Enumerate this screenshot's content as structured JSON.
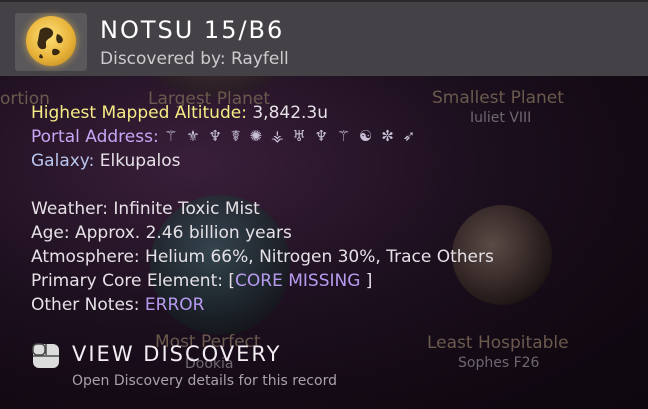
{
  "background": {
    "labels": {
      "portion": "ortion",
      "largest_planet": "Largest Planet",
      "smallest_planet": "Smallest Planet",
      "smallest_planet_name": "Iuliet VIII",
      "most_perfect": "Most Perfect",
      "most_perfect_name": "Dookia",
      "least_hospitable": "Least Hospitable",
      "least_hospitable_name": "Sophes F26"
    }
  },
  "header": {
    "title": "NOTSU 15/B6",
    "discovered_by": "Discovered by: Rayfell",
    "icon": "planet-icon"
  },
  "info": {
    "altitude_label": "Highest Mapped Altitude:",
    "altitude_value": "3,842.3u",
    "portal_label": "Portal Address:",
    "portal_glyphs": "⚚ ⚜ ♆ ☤ ✺ ⚶ ♅ ♆ ⚚ ☯ ✼ ➶",
    "galaxy_label": "Galaxy:",
    "galaxy_value": "Elkupalos",
    "weather_label": "Weather:",
    "weather_value": "Infinite Toxic Mist",
    "age_label": "Age:",
    "age_value": "Approx. 2.46 billion years",
    "atmosphere_label": "Atmosphere:",
    "atmosphere_value": "Helium 66%, Nitrogen 30%, Trace Others",
    "core_label": "Primary Core Element:",
    "core_open": "[",
    "core_value": "CORE MISSING",
    "core_close": "]",
    "notes_label": "Other Notes:",
    "notes_value": "ERROR"
  },
  "footer": {
    "view_label": "VIEW DISCOVERY",
    "view_sub": "Open Discovery details for this record",
    "icon": "mouse-icon"
  }
}
